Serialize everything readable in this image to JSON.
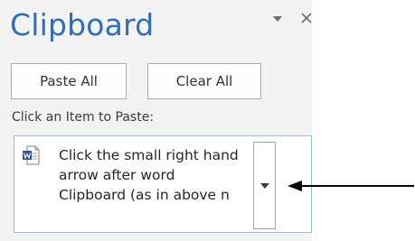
{
  "pane": {
    "title": "Clipboard",
    "options_icon": "chevron-down-icon",
    "close_icon": "close-icon"
  },
  "toolbar": {
    "paste_all_label": "Paste All",
    "clear_all_label": "Clear All"
  },
  "hint_text": "Click an Item to Paste:",
  "items": [
    {
      "icon": "word-document-icon",
      "lines": [
        "Click the small right hand",
        "arrow after word",
        "Clipboard (as in above n"
      ]
    }
  ],
  "colors": {
    "title": "#2f6eb5",
    "pane_bg": "#f3f3f3",
    "item_border": "#9ebadb",
    "annotation_arrow": "#000000"
  }
}
